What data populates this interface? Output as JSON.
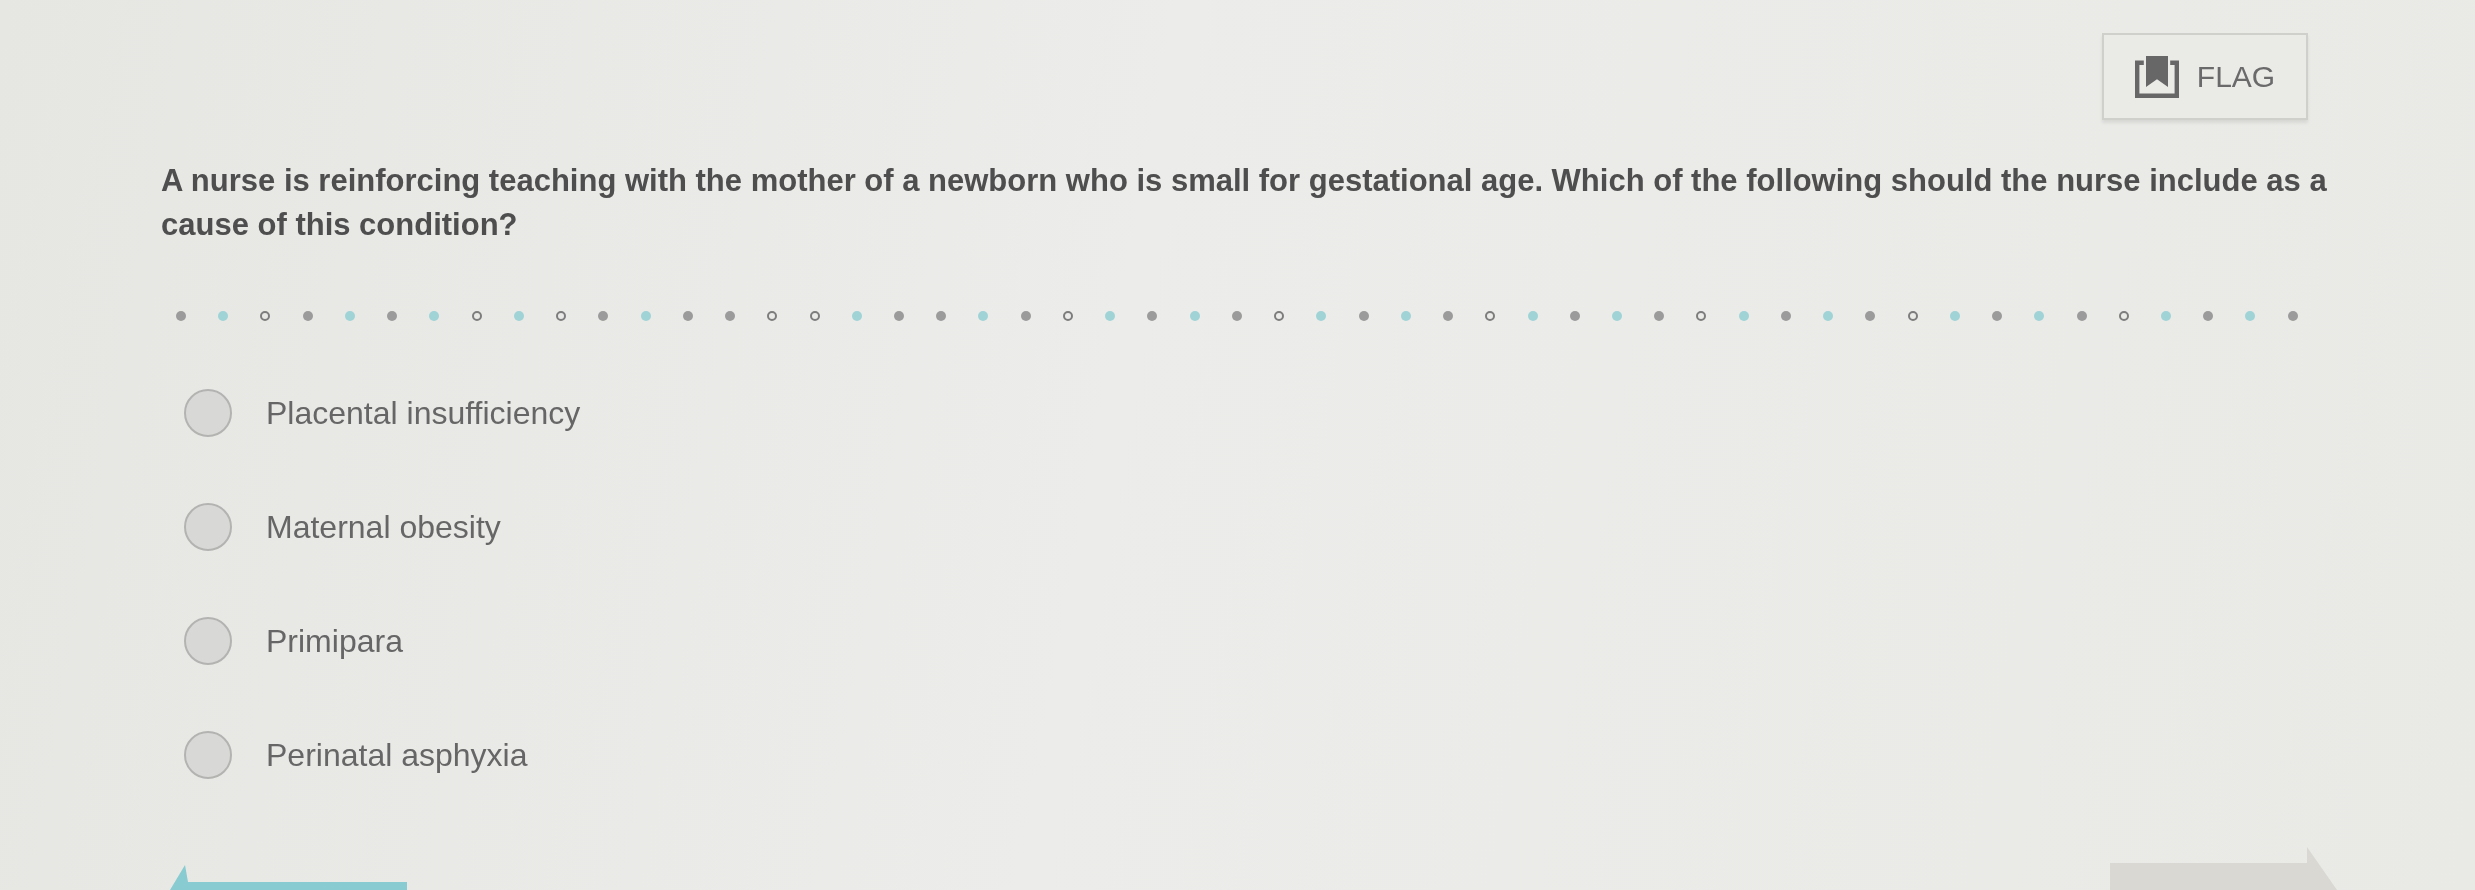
{
  "flag_button": {
    "label": "FLAG"
  },
  "question": {
    "text": "A nurse is reinforcing teaching with the mother of a newborn who is small for gestational age. Which of the following should the nurse include as a cause of this condition?"
  },
  "divider": {
    "dots": [
      {
        "kind": "dot",
        "color": "#9b9b9b"
      },
      {
        "kind": "dot",
        "color": "#9fd3d6"
      },
      {
        "kind": "ring",
        "color": "#7d7d7d"
      },
      {
        "kind": "dot",
        "color": "#9b9b9b"
      },
      {
        "kind": "dot",
        "color": "#9fd3d6"
      },
      {
        "kind": "dot",
        "color": "#9b9b9b"
      },
      {
        "kind": "dot",
        "color": "#9fd3d6"
      },
      {
        "kind": "ring",
        "color": "#7d7d7d"
      },
      {
        "kind": "dot",
        "color": "#9fd3d6"
      },
      {
        "kind": "ring",
        "color": "#7d7d7d"
      },
      {
        "kind": "dot",
        "color": "#9b9b9b"
      },
      {
        "kind": "dot",
        "color": "#9fd3d6"
      },
      {
        "kind": "dot",
        "color": "#9b9b9b"
      },
      {
        "kind": "dot",
        "color": "#9b9b9b"
      },
      {
        "kind": "ring",
        "color": "#7d7d7d"
      },
      {
        "kind": "ring",
        "color": "#7d7d7d"
      },
      {
        "kind": "dot",
        "color": "#9fd3d6"
      },
      {
        "kind": "dot",
        "color": "#9b9b9b"
      },
      {
        "kind": "dot",
        "color": "#9b9b9b"
      },
      {
        "kind": "dot",
        "color": "#9fd3d6"
      },
      {
        "kind": "dot",
        "color": "#9b9b9b"
      },
      {
        "kind": "ring",
        "color": "#7d7d7d"
      },
      {
        "kind": "dot",
        "color": "#9fd3d6"
      },
      {
        "kind": "dot",
        "color": "#9b9b9b"
      },
      {
        "kind": "dot",
        "color": "#9fd3d6"
      },
      {
        "kind": "dot",
        "color": "#9b9b9b"
      },
      {
        "kind": "ring",
        "color": "#7d7d7d"
      },
      {
        "kind": "dot",
        "color": "#9fd3d6"
      },
      {
        "kind": "dot",
        "color": "#9b9b9b"
      },
      {
        "kind": "dot",
        "color": "#9fd3d6"
      },
      {
        "kind": "dot",
        "color": "#9b9b9b"
      },
      {
        "kind": "ring",
        "color": "#7d7d7d"
      },
      {
        "kind": "dot",
        "color": "#9fd3d6"
      },
      {
        "kind": "dot",
        "color": "#9b9b9b"
      },
      {
        "kind": "dot",
        "color": "#9fd3d6"
      },
      {
        "kind": "dot",
        "color": "#9b9b9b"
      },
      {
        "kind": "ring",
        "color": "#7d7d7d"
      },
      {
        "kind": "dot",
        "color": "#9fd3d6"
      },
      {
        "kind": "dot",
        "color": "#9b9b9b"
      },
      {
        "kind": "dot",
        "color": "#9fd3d6"
      },
      {
        "kind": "dot",
        "color": "#9b9b9b"
      },
      {
        "kind": "ring",
        "color": "#7d7d7d"
      },
      {
        "kind": "dot",
        "color": "#9fd3d6"
      },
      {
        "kind": "dot",
        "color": "#9b9b9b"
      },
      {
        "kind": "dot",
        "color": "#9fd3d6"
      },
      {
        "kind": "dot",
        "color": "#9b9b9b"
      },
      {
        "kind": "ring",
        "color": "#7d7d7d"
      },
      {
        "kind": "dot",
        "color": "#9fd3d6"
      },
      {
        "kind": "dot",
        "color": "#9b9b9b"
      },
      {
        "kind": "dot",
        "color": "#9fd3d6"
      },
      {
        "kind": "dot",
        "color": "#9b9b9b"
      }
    ]
  },
  "options": [
    {
      "label": "Placental insufficiency",
      "selected": false
    },
    {
      "label": "Maternal obesity",
      "selected": false
    },
    {
      "label": "Primipara",
      "selected": false
    },
    {
      "label": "Perinatal asphyxia",
      "selected": false
    }
  ],
  "nav_buttons": [
    {
      "kind": "back",
      "disabled": false
    },
    {
      "kind": "next",
      "disabled": true
    }
  ]
}
